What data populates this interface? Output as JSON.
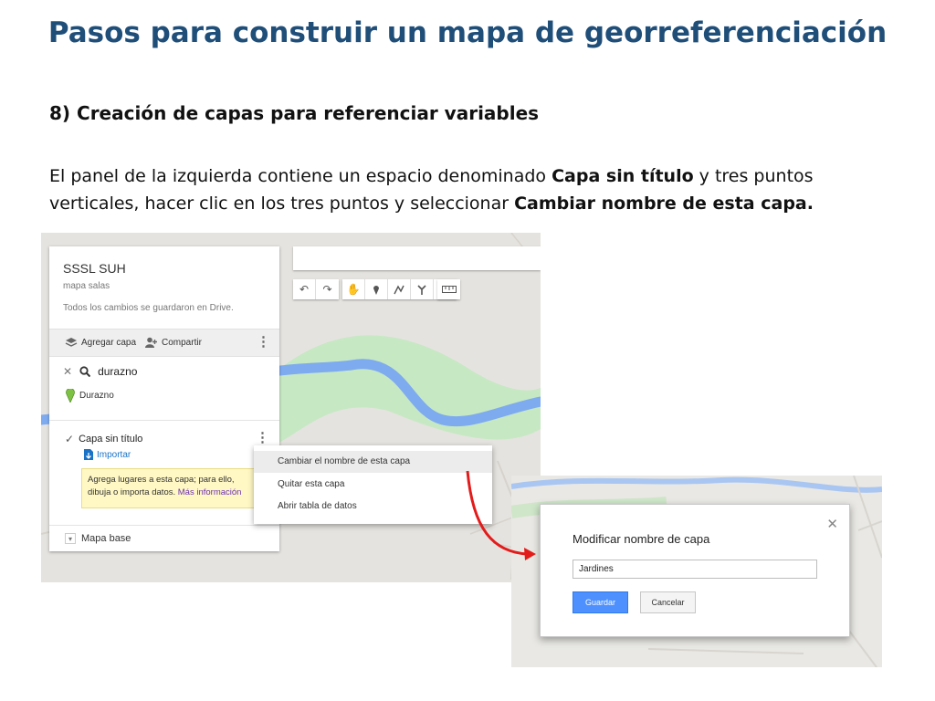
{
  "slide": {
    "title": "Pasos para construir un mapa de georreferenciación",
    "step_heading": "8) Creación de capas para referenciar variables",
    "instructions": {
      "part1": "El panel de la izquierda contiene un espacio denominado ",
      "bold1": "Capa sin título",
      "part2": " y tres puntos verticales, hacer clic en los tres puntos y seleccionar ",
      "bold2": "Cambiar nombre de esta capa."
    }
  },
  "panel": {
    "map_name": "SSSL SUH",
    "map_description": "mapa salas",
    "save_status": "Todos los cambios se guardaron en Drive.",
    "add_layer": "Agregar capa",
    "share": "Compartir",
    "search_query": "durazno",
    "search_result": "Durazno",
    "layer_name": "Capa sin título",
    "import": "Importar",
    "hint_line1": "Agrega lugares a esta capa; para ello,",
    "hint_line2": "dibuja o importa datos.",
    "hint_link": "Más información",
    "base_map": "Mapa base"
  },
  "context_menu": {
    "items": [
      "Cambiar el nombre de esta capa",
      "Quitar esta capa",
      "Abrir tabla de datos"
    ]
  },
  "dialog": {
    "title": "Modificar nombre de capa",
    "input_value": "Jardines",
    "save_label": "Guardar",
    "cancel_label": "Cancelar"
  },
  "colors": {
    "title": "#1f4e79",
    "river": "#7eaaf0",
    "park": "#c6e8c3",
    "map_bg": "#e5e3df",
    "primary_button": "#4d90fe",
    "arrow": "#e31b1b"
  },
  "icons": {
    "toolbar": [
      "undo-icon",
      "redo-icon",
      "hand-icon",
      "marker-icon",
      "draw-line-icon",
      "directions-icon",
      "ruler-icon"
    ]
  }
}
